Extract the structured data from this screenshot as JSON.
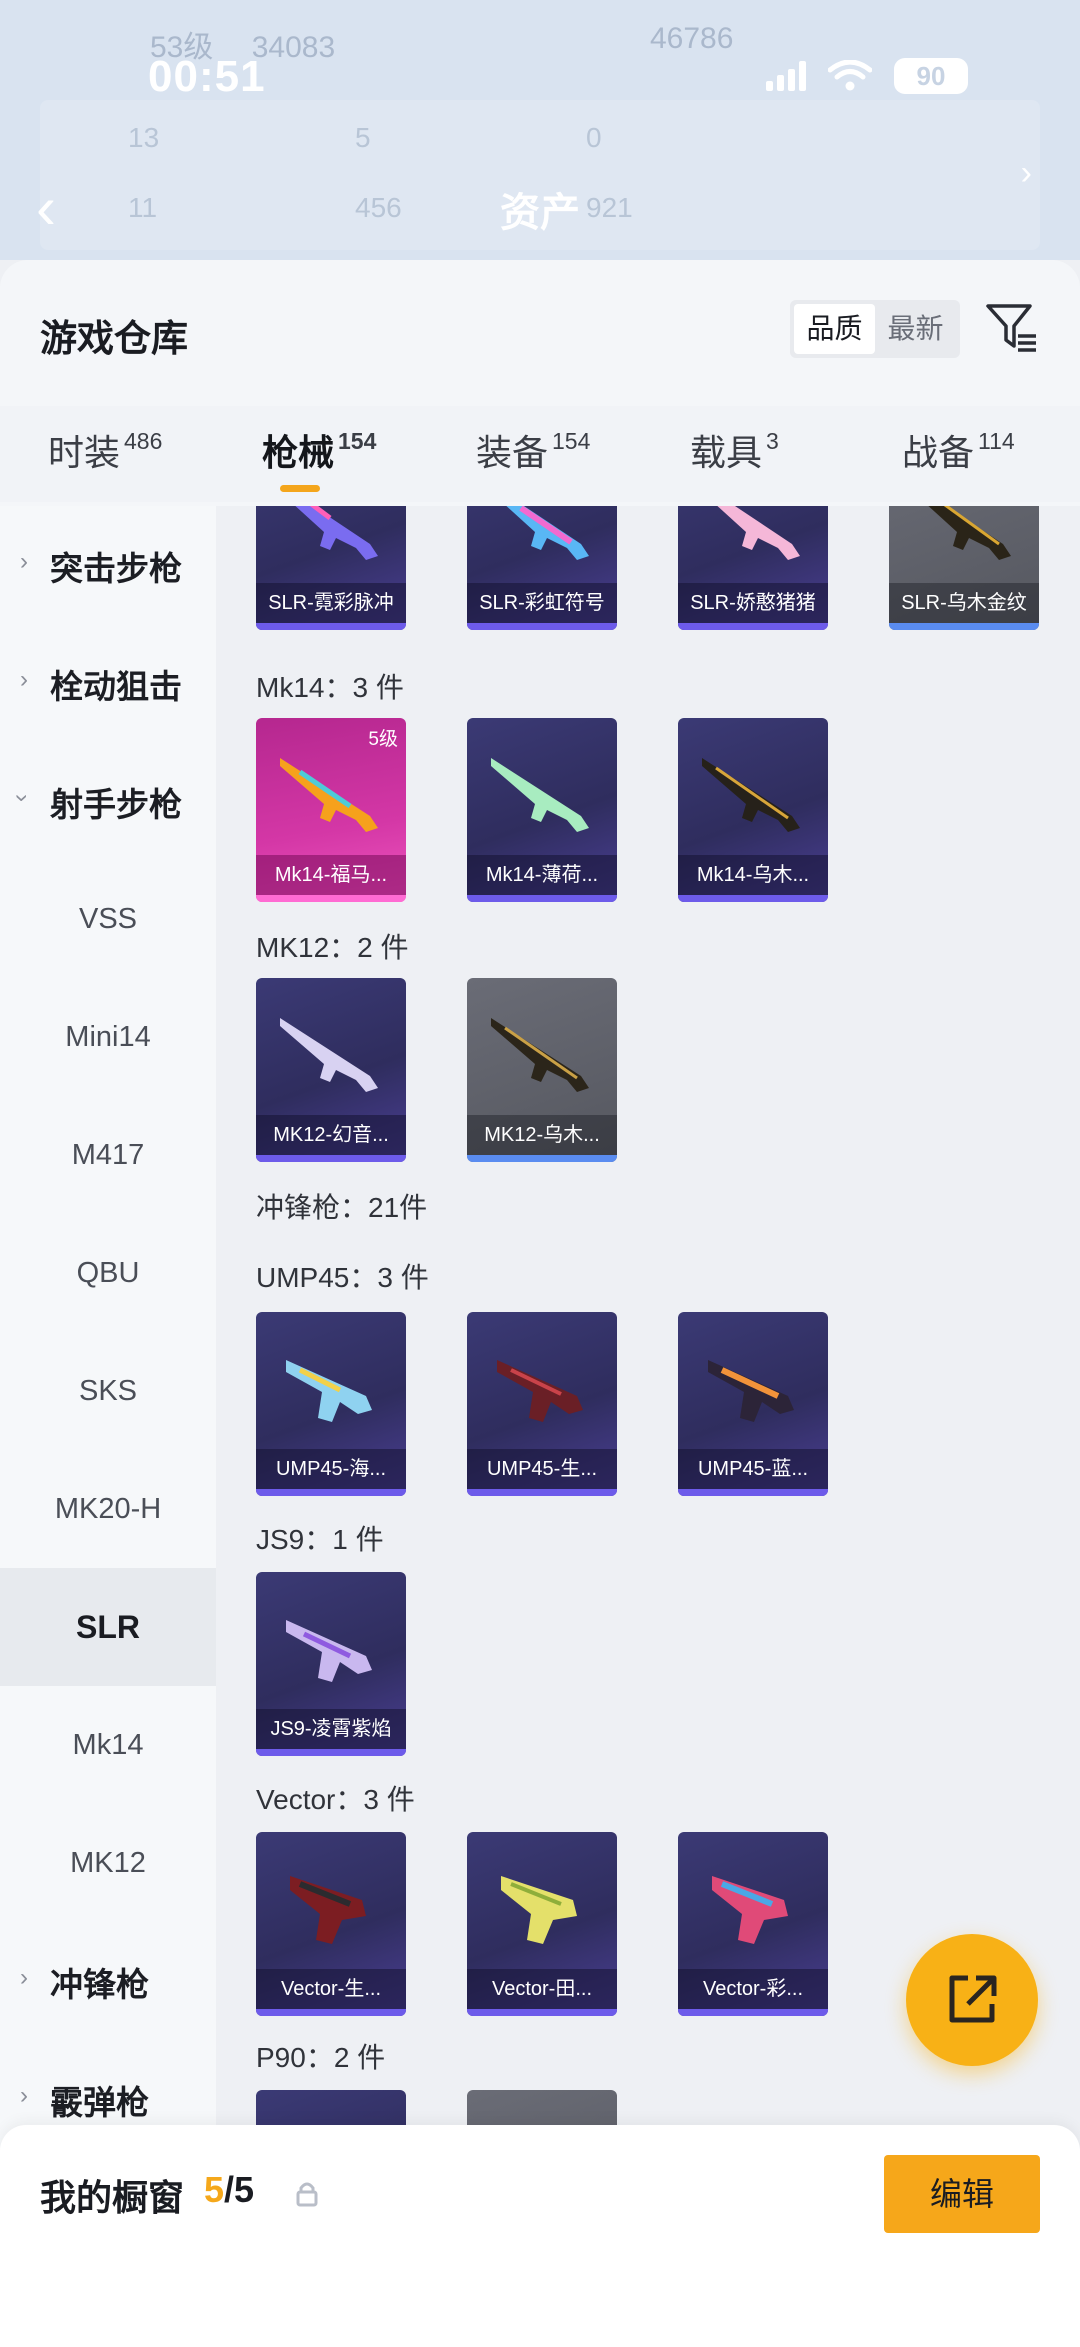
{
  "status": {
    "time": "00:51",
    "battery": "90"
  },
  "background": {
    "level": "53级",
    "coins": "34083",
    "fans": "46786",
    "stat_a": "13",
    "stat_b": "5",
    "stat_c": "0",
    "stat_d": "11",
    "stat_e": "456",
    "stat_f": "921",
    "title": "资产"
  },
  "header": {
    "title": "游戏仓库",
    "sort": {
      "quality": "品质",
      "newest": "最新"
    }
  },
  "tabs": [
    {
      "label": "时装",
      "count": "486"
    },
    {
      "label": "枪械",
      "count": "154"
    },
    {
      "label": "装备",
      "count": "154"
    },
    {
      "label": "载具",
      "count": "3"
    },
    {
      "label": "战备",
      "count": "114"
    }
  ],
  "sidebar": {
    "groups": [
      {
        "label": "突击步枪",
        "expanded": false
      },
      {
        "label": "栓动狙击",
        "expanded": false
      },
      {
        "label": "射手步枪",
        "expanded": true
      },
      {
        "label": "冲锋枪",
        "expanded": false
      },
      {
        "label": "霰弹枪",
        "expanded": false
      }
    ],
    "subs": [
      "VSS",
      "Mini14",
      "M417",
      "QBU",
      "SKS",
      "MK20-H",
      "SLR",
      "Mk14",
      "MK12"
    ],
    "active_sub": "SLR"
  },
  "sections": {
    "slr_items": [
      "SLR-霓彩脉冲",
      "SLR-彩虹符号",
      "SLR-娇憨猪猪",
      "SLR-乌木金纹"
    ],
    "mk14": {
      "label": "Mk14：3 件",
      "items": [
        "Mk14-福马...",
        "Mk14-薄荷...",
        "Mk14-乌木..."
      ],
      "level": "5级"
    },
    "mk12": {
      "label": "MK12：2 件",
      "items": [
        "MK12-幻音...",
        "MK12-乌木..."
      ]
    },
    "smg": {
      "label": "冲锋枪：21件"
    },
    "ump45": {
      "label": "UMP45：3 件",
      "items": [
        "UMP45-海...",
        "UMP45-生...",
        "UMP45-蓝..."
      ]
    },
    "js9": {
      "label": "JS9：1 件",
      "items": [
        "JS9-凌霄紫焰"
      ]
    },
    "vector": {
      "label": "Vector：3 件",
      "items": [
        "Vector-生...",
        "Vector-田...",
        "Vector-彩..."
      ]
    },
    "p90": {
      "label": "P90：2 件"
    }
  },
  "showcase": {
    "title": "我的橱窗",
    "current": "5",
    "total": "/5",
    "edit": "编辑"
  },
  "colors": {
    "accent": "#f6a71a",
    "card": "#3b3a75",
    "rare": "#d437a6"
  }
}
